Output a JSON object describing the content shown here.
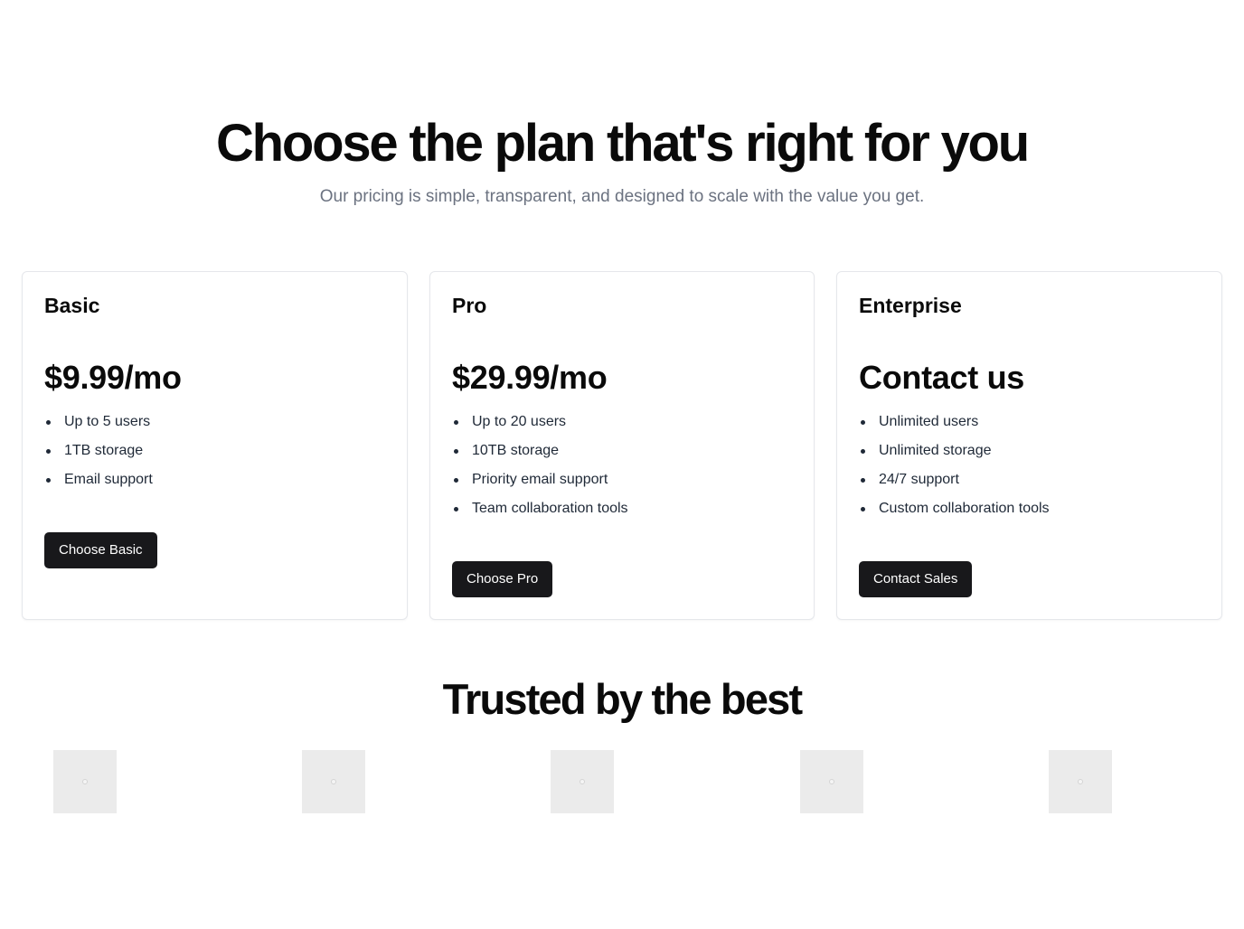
{
  "hero": {
    "title": "Choose the plan that's right for you",
    "subtitle": "Our pricing is simple, transparent, and designed to scale with the value you get."
  },
  "plans": [
    {
      "name": "Basic",
      "price": "$9.99/mo",
      "features": [
        "Up to 5 users",
        "1TB storage",
        "Email support"
      ],
      "cta": "Choose Basic"
    },
    {
      "name": "Pro",
      "price": "$29.99/mo",
      "features": [
        "Up to 20 users",
        "10TB storage",
        "Priority email support",
        "Team collaboration tools"
      ],
      "cta": "Choose Pro"
    },
    {
      "name": "Enterprise",
      "price": "Contact us",
      "features": [
        "Unlimited users",
        "Unlimited storage",
        "24/7 support",
        "Custom collaboration tools"
      ],
      "cta": "Contact Sales"
    }
  ],
  "trusted": {
    "title": "Trusted by the best",
    "logos": [
      "image-placeholder-icon",
      "image-placeholder-icon",
      "image-placeholder-icon",
      "image-placeholder-icon",
      "image-placeholder-icon"
    ]
  },
  "colors": {
    "button_bg": "#18181b",
    "button_text": "#ffffff",
    "subtitle": "#6b7280",
    "card_border": "#e5e7eb",
    "logo_placeholder": "#ebebeb"
  }
}
